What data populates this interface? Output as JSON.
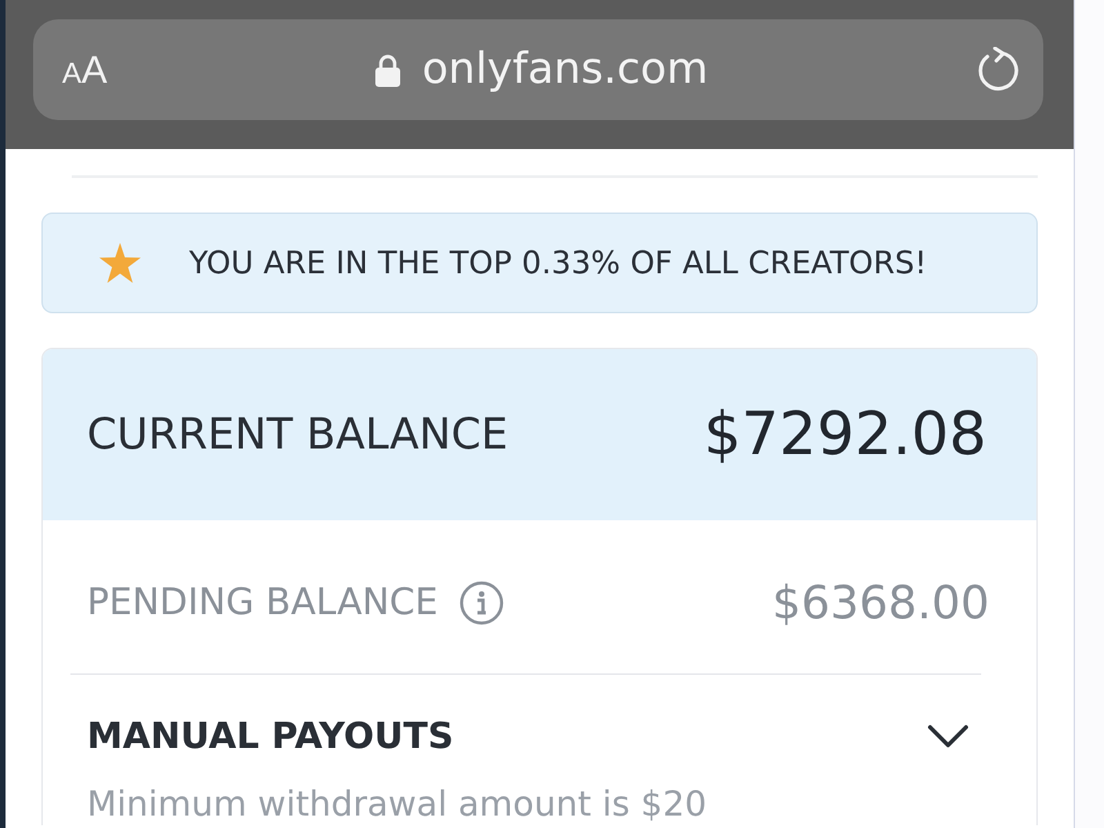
{
  "browser": {
    "text_size_button": "AA",
    "url": "onlyfans.com"
  },
  "banner": {
    "text": "YOU ARE IN THE TOP 0.33% OF ALL CREATORS!"
  },
  "current_balance": {
    "label": "CURRENT BALANCE",
    "amount": "$7292.08"
  },
  "pending_balance": {
    "label": "PENDING BALANCE",
    "amount": "$6368.00"
  },
  "manual_payouts": {
    "title": "MANUAL PAYOUTS",
    "expanded": false,
    "note": "Minimum withdrawal amount is $20"
  }
}
